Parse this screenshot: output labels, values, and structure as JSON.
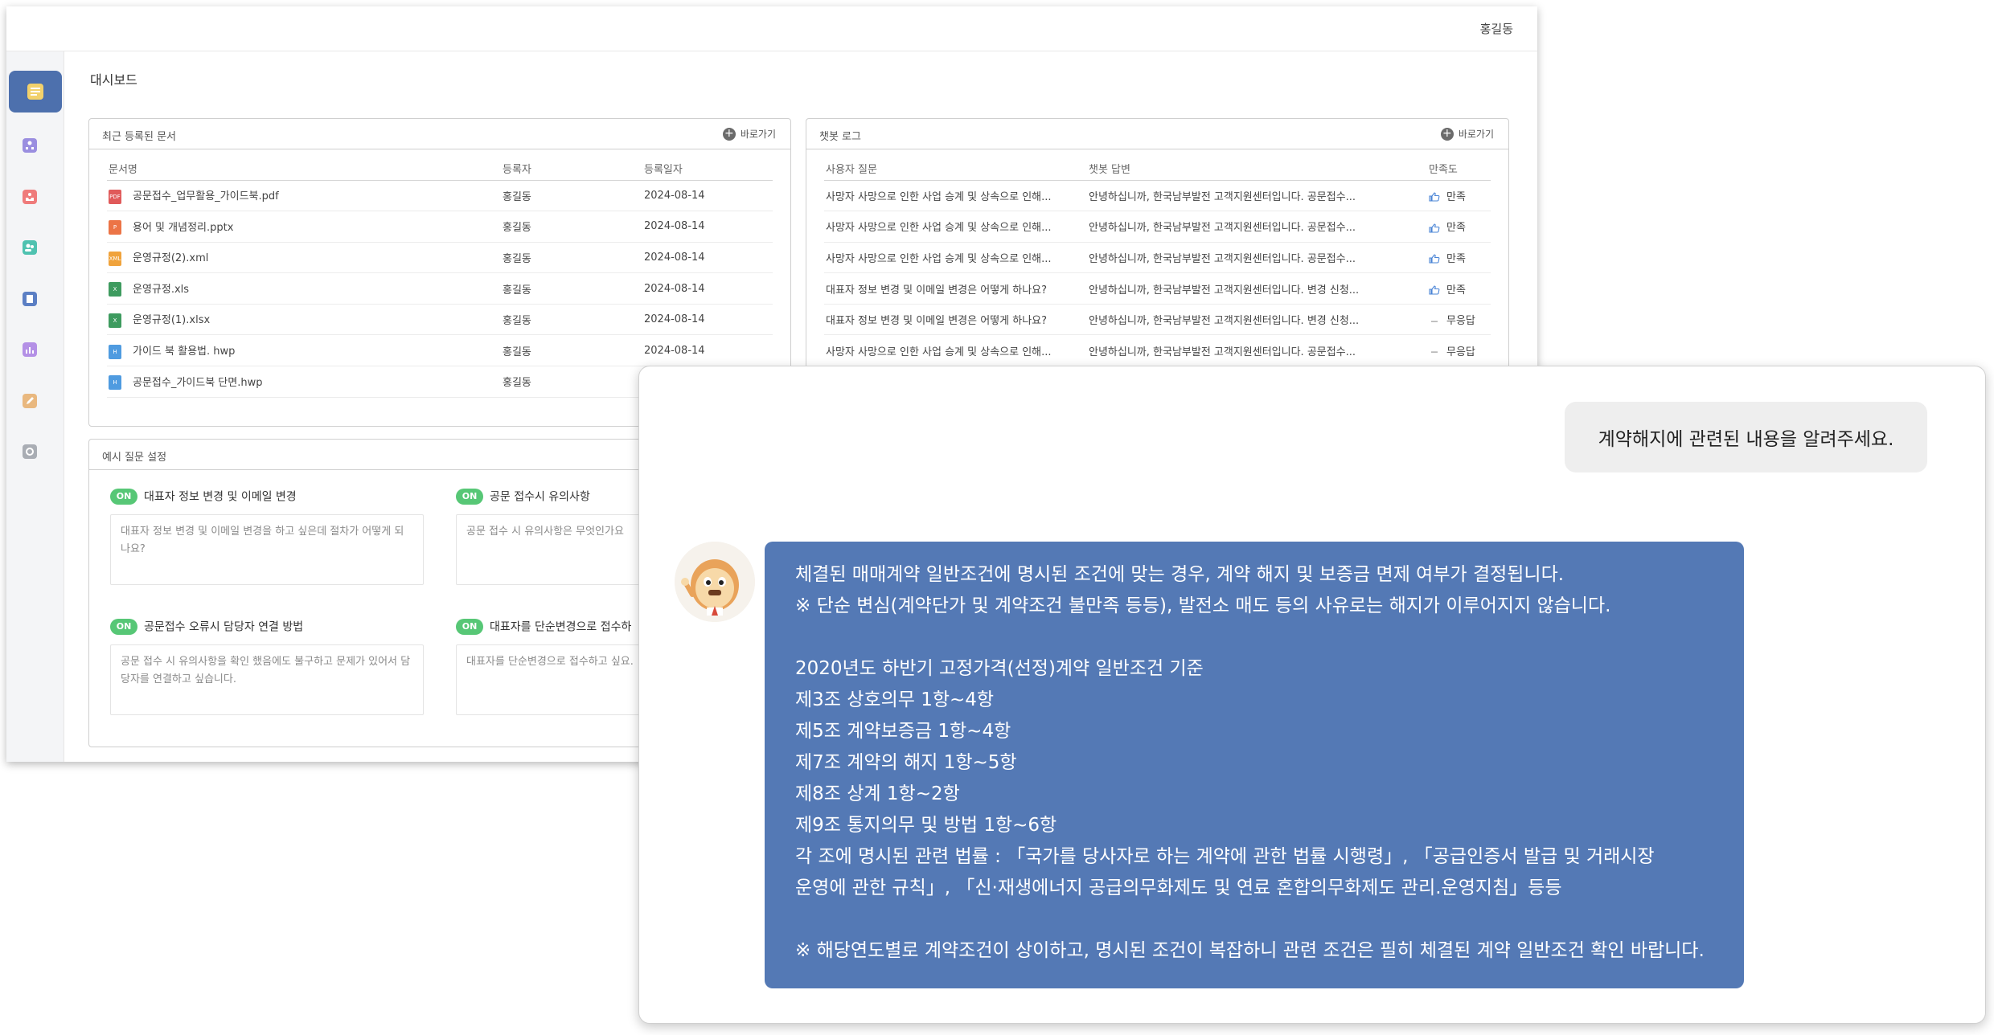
{
  "topbar": {
    "user_name": "홍길동"
  },
  "page_title": "대시보드",
  "goto_label": "바로가기",
  "recent_docs": {
    "title": "최근 등록된 문서",
    "columns": [
      "문서명",
      "등록자",
      "등록일자"
    ],
    "rows": [
      {
        "icon": "pdf-file-icon",
        "icon_text": "PDF",
        "icon_color": "#e05a5a",
        "name": "공문접수_업무활용_가이드북.pdf",
        "author": "홍길동",
        "date": "2024-08-14"
      },
      {
        "icon": "pptx-file-icon",
        "icon_text": "P",
        "icon_color": "#ec7446",
        "name": "용어 및 개념정리.pptx",
        "author": "홍길동",
        "date": "2024-08-14"
      },
      {
        "icon": "xml-file-icon",
        "icon_text": "XML",
        "icon_color": "#f0a33c",
        "name": "운영규정(2).xml",
        "author": "홍길동",
        "date": "2024-08-14"
      },
      {
        "icon": "xls-file-icon",
        "icon_text": "X",
        "icon_color": "#3e9b5f",
        "name": "운영규정.xls",
        "author": "홍길동",
        "date": "2024-08-14"
      },
      {
        "icon": "xlsx-file-icon",
        "icon_text": "X",
        "icon_color": "#3e9b5f",
        "name": "운영규정(1).xlsx",
        "author": "홍길동",
        "date": "2024-08-14"
      },
      {
        "icon": "hwp-file-icon",
        "icon_text": "H",
        "icon_color": "#4f9be0",
        "name": "가이드 북 활용법. hwp",
        "author": "홍길동",
        "date": "2024-08-14"
      },
      {
        "icon": "hwp-file-icon",
        "icon_text": "H",
        "icon_color": "#4f9be0",
        "name": "공문접수_가이드북 단면.hwp",
        "author": "홍길동",
        "date": ""
      }
    ]
  },
  "chatbot_log": {
    "title": "챗봇 로그",
    "columns": [
      "사용자 질문",
      "챗봇 답변",
      "만족도"
    ],
    "rows": [
      {
        "question": "사망자 사망으로 인한 사업 승계 및 상속으로 인해...",
        "answer": "안녕하십니까, 한국남부발전 고객지원센터입니다. 공문접수...",
        "satisfaction": "만족",
        "type": "good"
      },
      {
        "question": "사망자 사망으로 인한 사업 승계 및 상속으로 인해...",
        "answer": "안녕하십니까, 한국남부발전 고객지원센터입니다. 공문접수...",
        "satisfaction": "만족",
        "type": "good"
      },
      {
        "question": "사망자 사망으로 인한 사업 승계 및 상속으로 인해...",
        "answer": "안녕하십니까, 한국남부발전 고객지원센터입니다. 공문접수...",
        "satisfaction": "만족",
        "type": "good"
      },
      {
        "question": "대표자 정보 변경 및 이메일 변경은 어떻게 하나요?",
        "answer": "안녕하십니까, 한국남부발전 고객지원센터입니다. 변경 신청...",
        "satisfaction": "만족",
        "type": "good"
      },
      {
        "question": "대표자 정보 변경 및 이메일 변경은 어떻게 하나요?",
        "answer": "안녕하십니까, 한국남부발전 고객지원센터입니다. 변경 신청...",
        "satisfaction": "무응답",
        "type": "none"
      },
      {
        "question": "사망자 사망으로 인한 사업 승계 및 상속으로 인해...",
        "answer": "안녕하십니까, 한국남부발전 고객지원센터입니다. 공문접수...",
        "satisfaction": "무응답",
        "type": "none"
      }
    ]
  },
  "sample_questions": {
    "title": "예시 질문 설정",
    "badge": "ON",
    "items": [
      {
        "title": "대표자 정보 변경 및 이메일 변경",
        "text": "대표자 정보 변경 및 이메일 변경을 하고 싶은데 절차가 어떻게 되나요?"
      },
      {
        "title": "공문 접수시 유의사항",
        "text": "공문 접수 시 유의사항은 무엇인가요"
      },
      {
        "title": "공문접수 오류시 담당자 연결 방법",
        "text": "공문 접수 시 유의사항을 확인 했음에도 불구하고 문제가 있어서 담당자를 연결하고 싶습니다."
      },
      {
        "title": "대표자를 단순변경으로 접수하",
        "text": "대표자를 단순변경으로 접수하고 싶요."
      }
    ]
  },
  "chat": {
    "user_message": "계약해지에 관련된 내용을 알려주세요.",
    "bot_lines": [
      "체결된 매매계약 일반조건에 명시된 조건에 맞는 경우, 계약 해지 및 보증금 면제 여부가 결정됩니다.",
      "※ 단순 변심(계약단가 및 계약조건 불만족 등등), 발전소 매도 등의 사유로는 해지가 이루어지지 않습니다.",
      "",
      "2020년도 하반기 고정가격(선정)계약 일반조건 기준",
      "제3조 상호의무 1항~4항",
      "제5조 계약보증금 1항~4항",
      "제7조 계약의 해지 1항~5항",
      "제8조 상계 1항~2항",
      "제9조 통지의무 및 방법 1항~6항",
      "각 조에 명시된 관련 법률 : 「국가를 당사자로 하는 계약에 관한 법률 시행령」, 「공급인증서 발급 및 거래시장",
      "운영에 관한 규칙」, 「신·재생에너지 공급의무화제도 및 연료 혼합의무화제도 관리.운영지침」등등",
      "",
      "※ 해당연도별로 계약조건이 상이하고, 명시된 조건이 복잡하니 관련 조건은 필히 체결된 계약 일반조건 확인 바랍니다."
    ]
  },
  "sidebar": {
    "items": [
      {
        "icon": "dashboard-icon",
        "color": "#f2d16b",
        "active": true
      },
      {
        "icon": "org-chart-icon",
        "color": "#9a8ee0"
      },
      {
        "icon": "inbox-icon",
        "color": "#ef7b7b"
      },
      {
        "icon": "users-icon",
        "color": "#4fc2b0"
      },
      {
        "icon": "document-icon",
        "color": "#5b7fc4"
      },
      {
        "icon": "bar-chart-icon",
        "color": "#b490e6"
      },
      {
        "icon": "edit-icon",
        "color": "#e9b87f"
      },
      {
        "icon": "settings-icon",
        "color": "#a9adb4"
      }
    ]
  }
}
